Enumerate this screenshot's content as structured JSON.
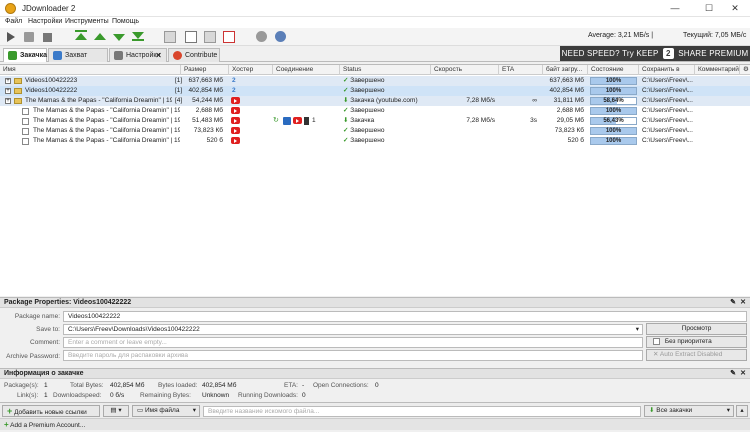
{
  "window": {
    "title": "JDownloader 2",
    "minimize": "—",
    "maximize": "☐",
    "close": "✕"
  },
  "menu": [
    "Файл",
    "Настройки",
    "Инструменты",
    "Помощь"
  ],
  "toolbar": {
    "average": "Average: 3,21 МБ/s |",
    "current": "Текущий: 7,05 МБ/с"
  },
  "tabs": [
    {
      "label": "Закачка",
      "color": "#3a9a2c"
    },
    {
      "label": "Захват ссылок",
      "color": "#3a7ac9"
    },
    {
      "label": "Настройки",
      "color": "#777777"
    },
    {
      "label": "Contribute",
      "color": "#d9452b"
    }
  ],
  "premium": {
    "a": "NEED SPEED? Try KEEP",
    "num": "2",
    "b": "SHARE PREMIUM"
  },
  "columns": [
    "Имя",
    "Размер",
    "Хостер",
    "Соединение",
    "Status",
    "Скорость",
    "ETA",
    "байт загру...",
    "Состояние",
    "Сохранить в",
    "Комментарий"
  ],
  "rows": [
    {
      "type": "pkg",
      "sel": false,
      "name": "Videos100422223",
      "count": "[1]",
      "size": "637,663 Мб",
      "host": "2",
      "conn": "",
      "status": "Завершено",
      "speed": "",
      "eta": "",
      "loaded": "637,663 Мб",
      "progress": 100,
      "progress_label": "100%",
      "save": "C:\\Users\\Freev\\...",
      "comment": ""
    },
    {
      "type": "pkg",
      "sel": true,
      "name": "Videos100422222",
      "count": "[1]",
      "size": "402,854 Мб",
      "host": "2",
      "conn": "",
      "status": "Завершено",
      "speed": "",
      "eta": "",
      "loaded": "402,854 Мб",
      "progress": 100,
      "progress_label": "100%",
      "save": "C:\\Users\\Freev\\...",
      "comment": ""
    },
    {
      "type": "pkg",
      "sel": false,
      "name": "The Mamas & the Papas - \"California Dreamin\" | 1998 I...",
      "count": "[4]",
      "size": "54,244 Мб",
      "host": "yt",
      "conn": "",
      "status": "Закачка (youtube.com)",
      "speed": "7,28 Mб/s",
      "eta": "∞",
      "loaded": "31,811 Мб",
      "progress": 58.64,
      "progress_label": "58,64%",
      "save": "C:\\Users\\Freev\\...",
      "comment": ""
    },
    {
      "type": "item",
      "sel": false,
      "name": "The Mamas & the Papas - \"California Dreamin\" | 1998 Ind...",
      "count": "",
      "size": "2,688 Мб",
      "host": "yt",
      "conn": "",
      "status": "Завершено",
      "speed": "",
      "eta": "",
      "loaded": "2,688 Мб",
      "progress": 100,
      "progress_label": "100%",
      "save": "C:\\Users\\Freev\\...",
      "comment": ""
    },
    {
      "type": "item",
      "sel": false,
      "name": "The Mamas & the Papas - \"California Dreamin\" | 1998 Ind...",
      "count": "",
      "size": "51,483 Мб",
      "host": "yt",
      "conn": "1",
      "status": "Закачка",
      "speed": "7,28 Mб/s",
      "eta": "3s",
      "loaded": "29,05 Мб",
      "progress": 56.43,
      "progress_label": "56,43%",
      "save": "C:\\Users\\Freev\\...",
      "comment": ""
    },
    {
      "type": "item",
      "sel": false,
      "name": "The Mamas & the Papas - \"California Dreamin\" | 1998 Ind...",
      "count": "",
      "size": "73,823 Кб",
      "host": "yt",
      "conn": "",
      "status": "Завершено",
      "speed": "",
      "eta": "",
      "loaded": "73,823 Кб",
      "progress": 100,
      "progress_label": "100%",
      "save": "C:\\Users\\Freev\\...",
      "comment": ""
    },
    {
      "type": "item",
      "sel": false,
      "name": "The Mamas & the Papas - \"California Dreamin\" | 1998 Ind...",
      "count": "",
      "size": "520 б",
      "host": "yt",
      "conn": "",
      "status": "Завершено",
      "speed": "",
      "eta": "",
      "loaded": "520 б",
      "progress": 100,
      "progress_label": "100%",
      "save": "C:\\Users\\Freev\\...",
      "comment": ""
    }
  ],
  "package_props": {
    "header": "Package Properties: Videos100422222",
    "name_label": "Package name:",
    "name_value": "Videos100422222",
    "save_label": "Save to:",
    "save_value": "C:\\Users\\Freev\\Downloads\\Videos100422222",
    "browse": "Просмотр",
    "comment_label": "Comment:",
    "comment_placeholder": "Enter a comment or leave empty...",
    "priority": "Без приоритета",
    "password_label": "Archive Password:",
    "password_placeholder": "Введите пароль для распаковки архива",
    "auto_extract": "Auto Extract Disabled"
  },
  "info": {
    "header": "Информация о закачке",
    "packages_label": "Package(s):",
    "packages": "1",
    "total_label": "Total Bytes:",
    "total": "402,854 Мб",
    "loaded_label": "Bytes loaded:",
    "loaded": "402,854 Мб",
    "eta_label": "ETA:",
    "eta": "-",
    "open_label": "Open Connections:",
    "open": "0",
    "links_label": "Link(s):",
    "links": "1",
    "dlspeed_label": "Downloadspeed:",
    "dlspeed": "0 б/s",
    "remaining_label": "Remaining Bytes:",
    "remaining": "Unknown",
    "running_label": "Running Downloads:",
    "running": "0"
  },
  "bottom": {
    "add_links": "Добавить новые ссылки",
    "filename": "Имя файла",
    "search_placeholder": "Введите название искомого файла...",
    "all_downloads": "Все закачки"
  },
  "status": {
    "add_premium": "Add a Premium Account..."
  }
}
